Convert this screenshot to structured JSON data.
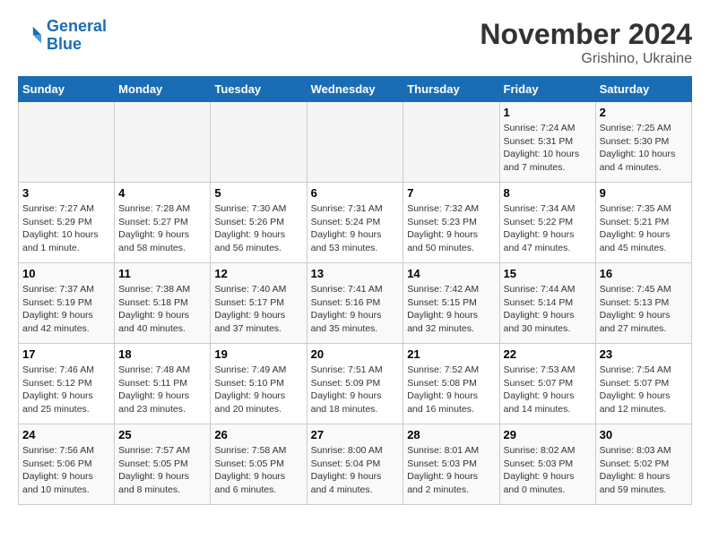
{
  "header": {
    "logo_general": "General",
    "logo_blue": "Blue",
    "month": "November 2024",
    "location": "Grishino, Ukraine"
  },
  "weekdays": [
    "Sunday",
    "Monday",
    "Tuesday",
    "Wednesday",
    "Thursday",
    "Friday",
    "Saturday"
  ],
  "weeks": [
    [
      {
        "day": "",
        "info": ""
      },
      {
        "day": "",
        "info": ""
      },
      {
        "day": "",
        "info": ""
      },
      {
        "day": "",
        "info": ""
      },
      {
        "day": "",
        "info": ""
      },
      {
        "day": "1",
        "info": "Sunrise: 7:24 AM\nSunset: 5:31 PM\nDaylight: 10 hours and 7 minutes."
      },
      {
        "day": "2",
        "info": "Sunrise: 7:25 AM\nSunset: 5:30 PM\nDaylight: 10 hours and 4 minutes."
      }
    ],
    [
      {
        "day": "3",
        "info": "Sunrise: 7:27 AM\nSunset: 5:29 PM\nDaylight: 10 hours and 1 minute."
      },
      {
        "day": "4",
        "info": "Sunrise: 7:28 AM\nSunset: 5:27 PM\nDaylight: 9 hours and 58 minutes."
      },
      {
        "day": "5",
        "info": "Sunrise: 7:30 AM\nSunset: 5:26 PM\nDaylight: 9 hours and 56 minutes."
      },
      {
        "day": "6",
        "info": "Sunrise: 7:31 AM\nSunset: 5:24 PM\nDaylight: 9 hours and 53 minutes."
      },
      {
        "day": "7",
        "info": "Sunrise: 7:32 AM\nSunset: 5:23 PM\nDaylight: 9 hours and 50 minutes."
      },
      {
        "day": "8",
        "info": "Sunrise: 7:34 AM\nSunset: 5:22 PM\nDaylight: 9 hours and 47 minutes."
      },
      {
        "day": "9",
        "info": "Sunrise: 7:35 AM\nSunset: 5:21 PM\nDaylight: 9 hours and 45 minutes."
      }
    ],
    [
      {
        "day": "10",
        "info": "Sunrise: 7:37 AM\nSunset: 5:19 PM\nDaylight: 9 hours and 42 minutes."
      },
      {
        "day": "11",
        "info": "Sunrise: 7:38 AM\nSunset: 5:18 PM\nDaylight: 9 hours and 40 minutes."
      },
      {
        "day": "12",
        "info": "Sunrise: 7:40 AM\nSunset: 5:17 PM\nDaylight: 9 hours and 37 minutes."
      },
      {
        "day": "13",
        "info": "Sunrise: 7:41 AM\nSunset: 5:16 PM\nDaylight: 9 hours and 35 minutes."
      },
      {
        "day": "14",
        "info": "Sunrise: 7:42 AM\nSunset: 5:15 PM\nDaylight: 9 hours and 32 minutes."
      },
      {
        "day": "15",
        "info": "Sunrise: 7:44 AM\nSunset: 5:14 PM\nDaylight: 9 hours and 30 minutes."
      },
      {
        "day": "16",
        "info": "Sunrise: 7:45 AM\nSunset: 5:13 PM\nDaylight: 9 hours and 27 minutes."
      }
    ],
    [
      {
        "day": "17",
        "info": "Sunrise: 7:46 AM\nSunset: 5:12 PM\nDaylight: 9 hours and 25 minutes."
      },
      {
        "day": "18",
        "info": "Sunrise: 7:48 AM\nSunset: 5:11 PM\nDaylight: 9 hours and 23 minutes."
      },
      {
        "day": "19",
        "info": "Sunrise: 7:49 AM\nSunset: 5:10 PM\nDaylight: 9 hours and 20 minutes."
      },
      {
        "day": "20",
        "info": "Sunrise: 7:51 AM\nSunset: 5:09 PM\nDaylight: 9 hours and 18 minutes."
      },
      {
        "day": "21",
        "info": "Sunrise: 7:52 AM\nSunset: 5:08 PM\nDaylight: 9 hours and 16 minutes."
      },
      {
        "day": "22",
        "info": "Sunrise: 7:53 AM\nSunset: 5:07 PM\nDaylight: 9 hours and 14 minutes."
      },
      {
        "day": "23",
        "info": "Sunrise: 7:54 AM\nSunset: 5:07 PM\nDaylight: 9 hours and 12 minutes."
      }
    ],
    [
      {
        "day": "24",
        "info": "Sunrise: 7:56 AM\nSunset: 5:06 PM\nDaylight: 9 hours and 10 minutes."
      },
      {
        "day": "25",
        "info": "Sunrise: 7:57 AM\nSunset: 5:05 PM\nDaylight: 9 hours and 8 minutes."
      },
      {
        "day": "26",
        "info": "Sunrise: 7:58 AM\nSunset: 5:05 PM\nDaylight: 9 hours and 6 minutes."
      },
      {
        "day": "27",
        "info": "Sunrise: 8:00 AM\nSunset: 5:04 PM\nDaylight: 9 hours and 4 minutes."
      },
      {
        "day": "28",
        "info": "Sunrise: 8:01 AM\nSunset: 5:03 PM\nDaylight: 9 hours and 2 minutes."
      },
      {
        "day": "29",
        "info": "Sunrise: 8:02 AM\nSunset: 5:03 PM\nDaylight: 9 hours and 0 minutes."
      },
      {
        "day": "30",
        "info": "Sunrise: 8:03 AM\nSunset: 5:02 PM\nDaylight: 8 hours and 59 minutes."
      }
    ]
  ]
}
